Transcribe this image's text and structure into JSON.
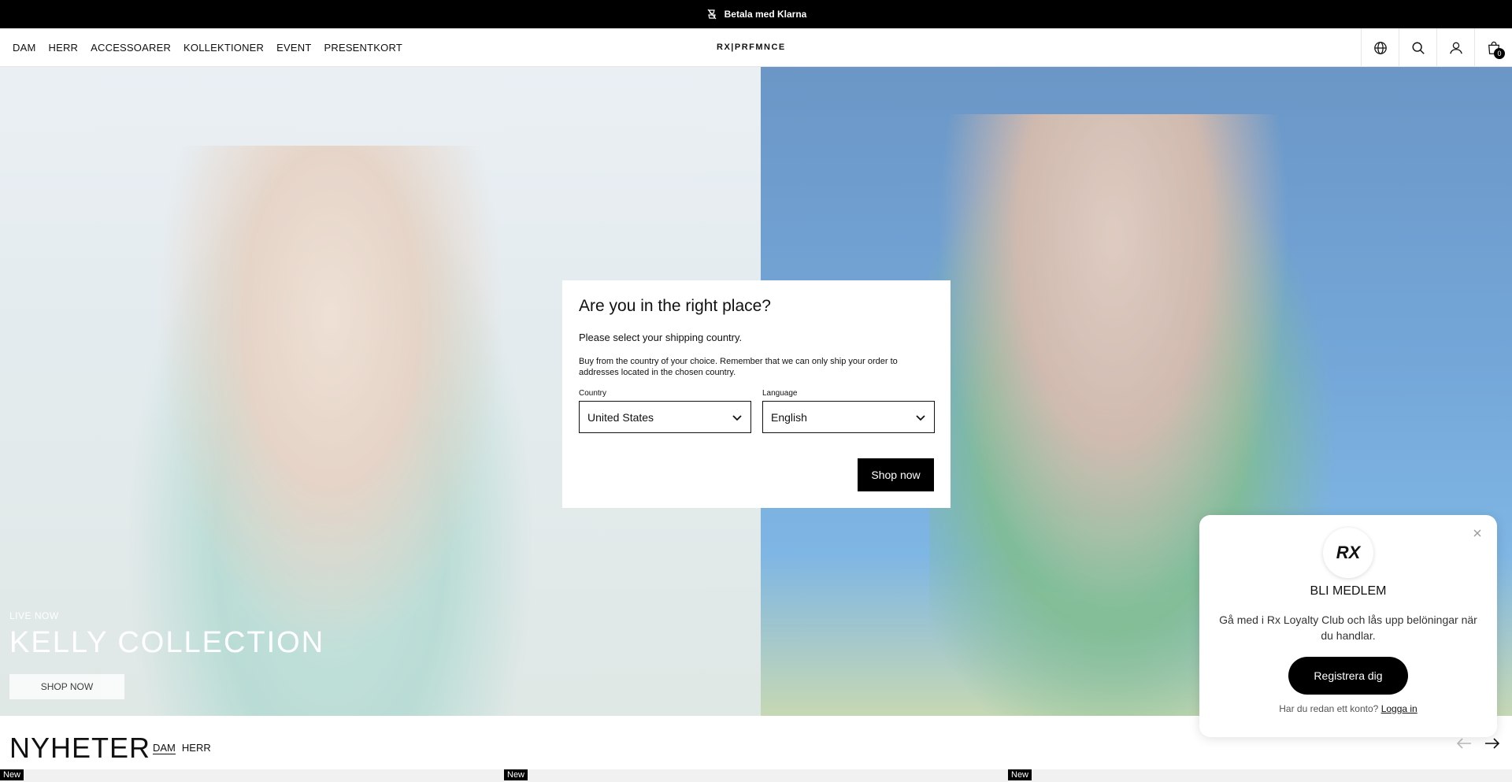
{
  "announcement": {
    "text": "Betala med Klarna",
    "icon": "klarna-icon"
  },
  "nav": {
    "items": [
      "DAM",
      "HERR",
      "ACCESSOARER",
      "KOLLEKTIONER",
      "EVENT",
      "PRESENTKORT"
    ]
  },
  "logo": "RX|PRFMNCE",
  "header_icons": {
    "globe": "globe-icon",
    "search": "search-icon",
    "account": "account-icon",
    "cart": "bag-icon",
    "cart_count": "0"
  },
  "hero": {
    "eyebrow": "LIVE NOW",
    "title": "KELLY COLLECTION",
    "cta": "SHOP NOW"
  },
  "nyheter": {
    "title": "NYHETER",
    "tabs": [
      "DAM",
      "HERR"
    ],
    "badge": "New"
  },
  "modal": {
    "title": "Are you in the right place?",
    "subtitle": "Please select your shipping country.",
    "description": "Buy from the country of your choice. Remember that we can only ship your order to addresses located in the chosen country.",
    "country_label": "Country",
    "country_value": "United States",
    "language_label": "Language",
    "language_value": "English",
    "button": "Shop now"
  },
  "loyalty": {
    "logo": "RX",
    "title": "BLI MEDLEM",
    "text": "Gå med i Rx Loyalty Club och lås upp belöningar när du handlar.",
    "button": "Registrera dig",
    "login_prompt": "Har du redan ett konto?",
    "login_link": "Logga in"
  }
}
